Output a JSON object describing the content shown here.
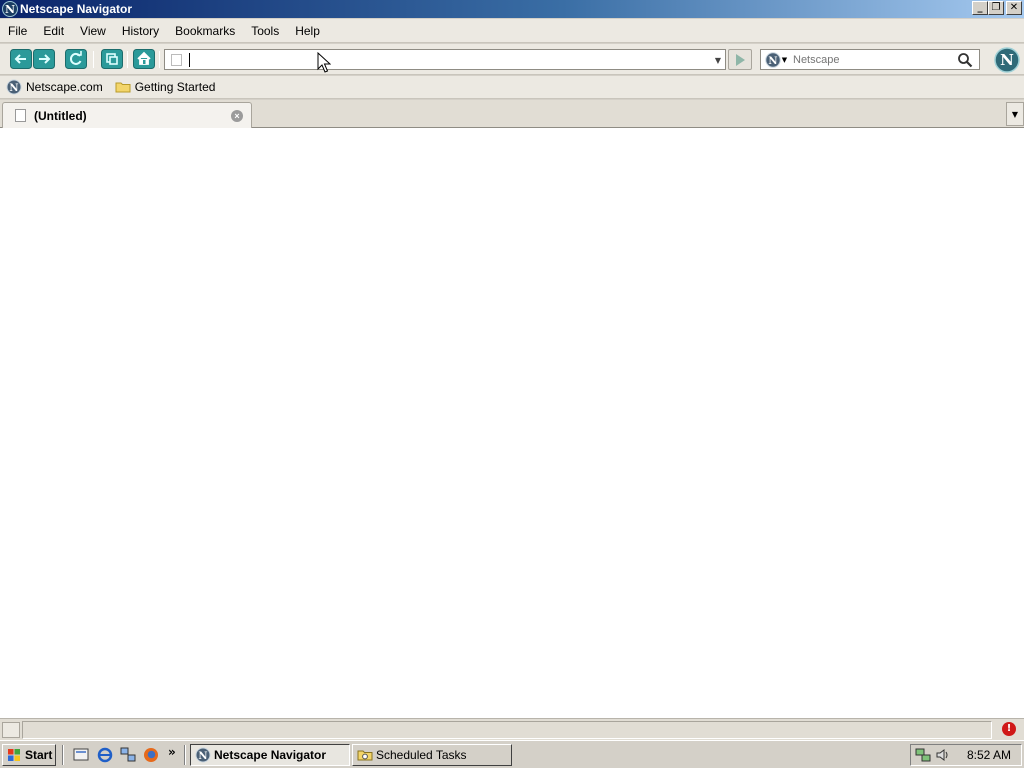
{
  "window": {
    "title": "Netscape Navigator",
    "controls": {
      "minimize": "_",
      "maximize": "❐",
      "close": "✕"
    }
  },
  "menu": {
    "items": [
      "File",
      "Edit",
      "View",
      "History",
      "Bookmarks",
      "Tools",
      "Help"
    ]
  },
  "navbar": {
    "url_value": "",
    "search_placeholder": "Netscape"
  },
  "bookmarks": {
    "items": [
      "Netscape.com",
      "Getting Started"
    ]
  },
  "tabs": {
    "items": [
      {
        "label": "(Untitled)"
      }
    ]
  },
  "taskbar": {
    "start_label": "Start",
    "quick_launch_more": "»",
    "tasks": [
      {
        "label": "Netscape Navigator",
        "active": true
      },
      {
        "label": "Scheduled Tasks",
        "active": false
      }
    ],
    "clock": "8:52 AM"
  },
  "icons": {
    "app": "netscape-n-icon",
    "back": "back-arrow-icon",
    "forward": "forward-arrow-icon",
    "reload": "reload-icon",
    "stop": "stop-icon",
    "home": "home-icon",
    "go": "go-arrow-icon",
    "search": "magnifier-icon",
    "folder": "folder-icon",
    "page": "page-icon",
    "close_tab": "close-tab-icon",
    "alert": "alert-icon"
  },
  "colors": {
    "title_bar_start": "#0a246a",
    "title_bar_end": "#a6caf0",
    "toolbar_teal": "#2b9a9a",
    "chrome_bg": "#ece9e2",
    "alert_red": "#d01818"
  }
}
